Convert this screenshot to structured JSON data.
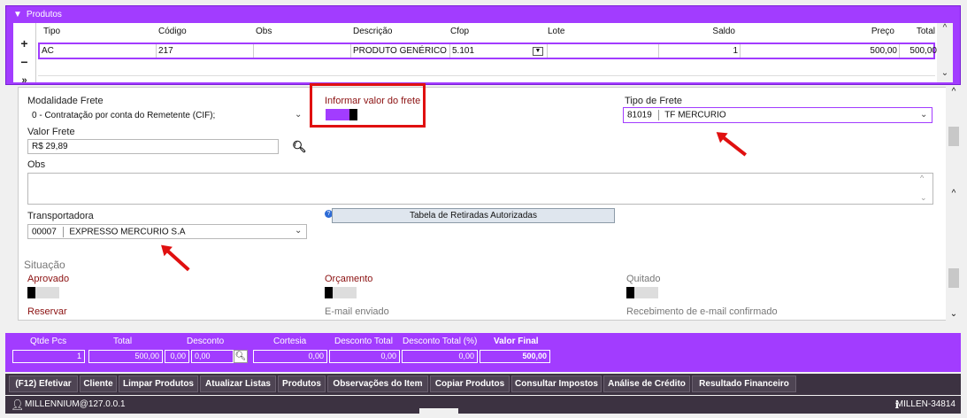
{
  "products": {
    "title": "Produtos",
    "add": "+",
    "remove": "−",
    "expand": "»",
    "columns": [
      "Tipo",
      "Código",
      "Obs",
      "Descrição",
      "Cfop",
      "Lote",
      "Saldo",
      "Preço",
      "Total"
    ],
    "row": {
      "tipo": "AC",
      "codigo": "217",
      "obs": "",
      "descricao": "PRODUTO GENÉRICO ...",
      "cfop": "5.101",
      "lote": "",
      "saldo": "1",
      "preco": "500,00",
      "total": "500,00"
    }
  },
  "form": {
    "modalidade_label": "Modalidade Frete",
    "modalidade_value": "0 - Contratação por conta do Remetente (CIF);",
    "informar_label": "Informar valor do frete",
    "tipo_frete_label": "Tipo de Frete",
    "tipo_frete_code": "81019",
    "tipo_frete_value": "TF MERCURIO",
    "valor_label": "Valor Frete",
    "valor_value": "R$ 29,89",
    "obs_label": "Obs",
    "transportadora_label": "Transportadora",
    "transportadora_code": "00007",
    "transportadora_value": "EXPRESSO MERCURIO S.A",
    "tabela_button": "Tabela de Retiradas Autorizadas",
    "situacao_label": "Situação",
    "aprovado_label": "Aprovado",
    "orcamento_label": "Orçamento",
    "quitado_label": "Quitado",
    "reservar_label": "Reservar",
    "email_label": "E-mail enviado",
    "recebimento_label": "Recebimento de e-mail confirmado"
  },
  "totals": {
    "qtde_label": "Qtde Pcs",
    "qtde": "1",
    "total_label": "Total",
    "total": "500,00",
    "desconto_label": "Desconto",
    "desconto_pct": "0,00",
    "desconto_val": "0,00",
    "cortesia_label": "Cortesia",
    "cortesia": "0,00",
    "desc_total_label": "Desconto Total",
    "desc_total": "0,00",
    "desc_total_pct_label": "Desconto Total (%)",
    "desc_total_pct": "0,00",
    "valor_final_label": "Valor Final",
    "valor_final": "500,00"
  },
  "actions": [
    "(F12) Efetivar",
    "Cliente",
    "Limpar Produtos",
    "Atualizar Listas",
    "Produtos",
    "Observações do Item",
    "Copiar Produtos",
    "Consultar Impostos",
    "Análise de Crédito",
    "Resultado Financeiro"
  ],
  "status": {
    "user": "MILLENNIUM@127.0.0.1",
    "server": "MILLEN-34814"
  },
  "colors": {
    "accent": "#a23cff",
    "highlight": "#e01010",
    "dark_bar": "#3c3241"
  }
}
